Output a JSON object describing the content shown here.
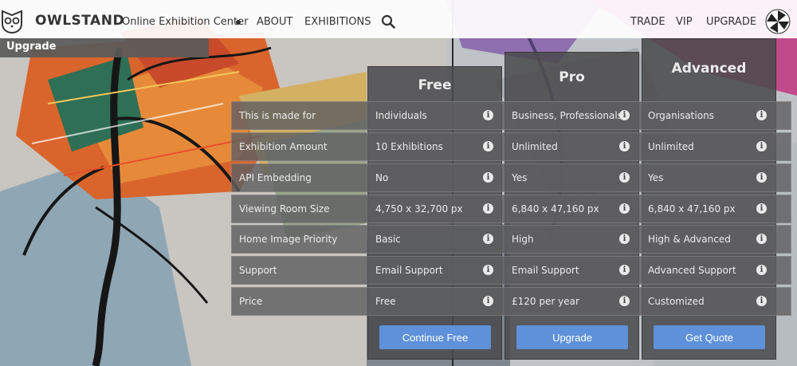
{
  "header": {
    "brand": "OWLSTAND",
    "tagline": "Online Exhibition Center",
    "nav_left": [
      "ABOUT",
      "EXHIBITIONS"
    ],
    "nav_right": [
      "TRADE",
      "VIP",
      "UPGRADE"
    ],
    "icons": {
      "logo": "owl-logo-icon",
      "search": "search-icon",
      "avatar": "avatar"
    }
  },
  "page_label": "Upgrade",
  "plans": [
    {
      "title": "Free",
      "button": "Continue Free"
    },
    {
      "title": "Pro",
      "button": "Upgrade"
    },
    {
      "title": "Advanced",
      "button": "Get Quote"
    }
  ],
  "features": [
    {
      "label": "This is made for",
      "values": [
        "Individuals",
        "Business, Professionals",
        "Organisations"
      ]
    },
    {
      "label": "Exhibition Amount",
      "values": [
        "10 Exhibitions",
        "Unlimited",
        "Unlimited"
      ]
    },
    {
      "label": "API Embedding",
      "values": [
        "No",
        "Yes",
        "Yes"
      ]
    },
    {
      "label": "Viewing Room Size",
      "values": [
        "4,750 x 32,700 px",
        "6,840 x 47,160 px",
        "6,840 x 47,160 px"
      ]
    },
    {
      "label": "Home Image Priority",
      "values": [
        "Basic",
        "High",
        "High & Advanced"
      ]
    },
    {
      "label": "Support",
      "values": [
        "Email Support",
        "Email Support",
        "Advanced Support"
      ]
    },
    {
      "label": "Price",
      "values": [
        "Free",
        "£120 per year",
        "Customized"
      ]
    }
  ],
  "info_glyph": "i",
  "colors": {
    "button_blue": "#5e91d9",
    "panel_dark": "#4b4b4d",
    "header_bg": "#ffffff"
  }
}
